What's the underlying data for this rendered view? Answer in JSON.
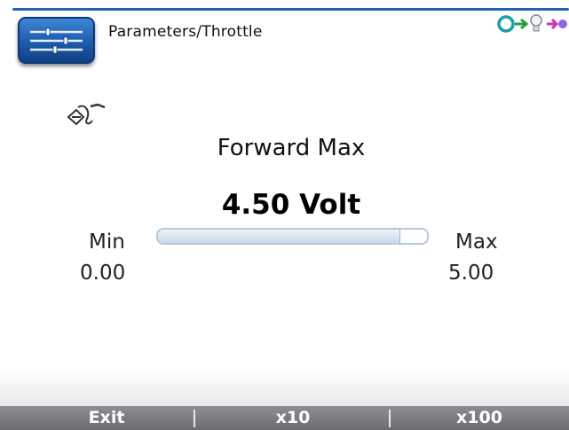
{
  "header": {
    "breadcrumb": "Parameters/Throttle",
    "app_icon": "sliders-icon",
    "status_icons": [
      "connection-loop-icon",
      "arrow-right-icon",
      "bulb-icon"
    ]
  },
  "parameter": {
    "icon": "throttle-icon",
    "name": "Forward Max",
    "value_text": "4.50 Volt",
    "value": 4.5,
    "unit": "Volt",
    "min_label": "Min",
    "min_value": "0.00",
    "max_label": "Max",
    "max_value": "5.00",
    "fill_fraction": 0.9
  },
  "softkeys": [
    {
      "label": "Exit"
    },
    {
      "label": "x10"
    },
    {
      "label": "x100"
    }
  ],
  "colors": {
    "accent": "#1f63b2",
    "softkey_bar": "#7b7d82",
    "bar_border": "#b6c8dc"
  }
}
